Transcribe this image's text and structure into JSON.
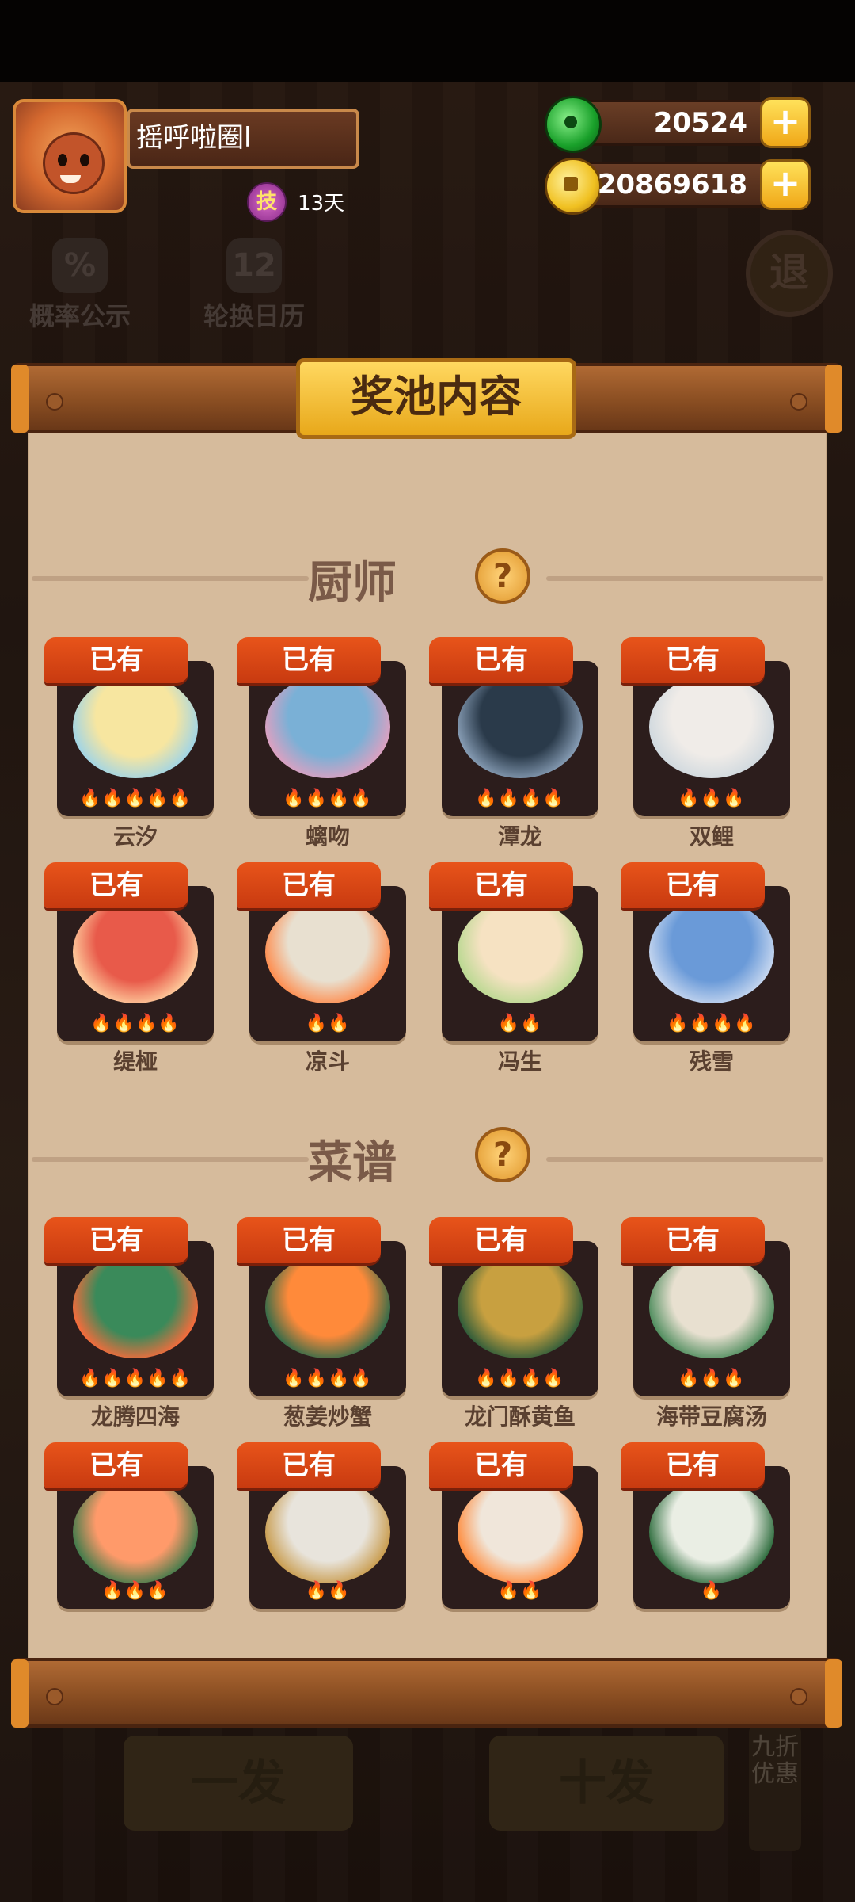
{
  "player": {
    "name": "摇呼啦圈l",
    "skill_badge": "技",
    "skill_days": "13天"
  },
  "currency": [
    {
      "name": "jade",
      "value": "20524"
    },
    {
      "name": "gold",
      "value": "20869618"
    }
  ],
  "side_buttons": {
    "probability": "概率公示",
    "calendar": "轮换日历",
    "exit": "退",
    "probability_icon": "%",
    "calendar_icon": "12"
  },
  "modal": {
    "title": "奖池内容",
    "help": "?"
  },
  "sections": {
    "chefs": {
      "title": "厨师",
      "items": [
        {
          "name": "云汐",
          "tag": "已有",
          "stars": 5
        },
        {
          "name": "螭吻",
          "tag": "已有",
          "stars": 4
        },
        {
          "name": "潭龙",
          "tag": "已有",
          "stars": 4
        },
        {
          "name": "双鲤",
          "tag": "已有",
          "stars": 3
        },
        {
          "name": "缇桠",
          "tag": "已有",
          "stars": 4
        },
        {
          "name": "凉斗",
          "tag": "已有",
          "stars": 2
        },
        {
          "name": "冯生",
          "tag": "已有",
          "stars": 2
        },
        {
          "name": "残雪",
          "tag": "已有",
          "stars": 4
        }
      ]
    },
    "recipes": {
      "title": "菜谱",
      "items": [
        {
          "name": "龙腾四海",
          "tag": "已有",
          "stars": 5
        },
        {
          "name": "葱姜炒蟹",
          "tag": "已有",
          "stars": 4
        },
        {
          "name": "龙门酥黄鱼",
          "tag": "已有",
          "stars": 4
        },
        {
          "name": "海带豆腐汤",
          "tag": "已有",
          "stars": 3
        },
        {
          "name": "",
          "tag": "已有",
          "stars": 3
        },
        {
          "name": "",
          "tag": "已有",
          "stars": 2
        },
        {
          "name": "",
          "tag": "已有",
          "stars": 2
        },
        {
          "name": "",
          "tag": "已有",
          "stars": 1
        }
      ]
    }
  },
  "bottom": {
    "single_draw": "一发",
    "ten_draw": "十发",
    "discount": "九折优惠"
  },
  "colors": {
    "owned_tag": "#d84a14",
    "plaque": "#f2c440",
    "paper": "#d6bb9c",
    "card": "#2c1d1c"
  }
}
